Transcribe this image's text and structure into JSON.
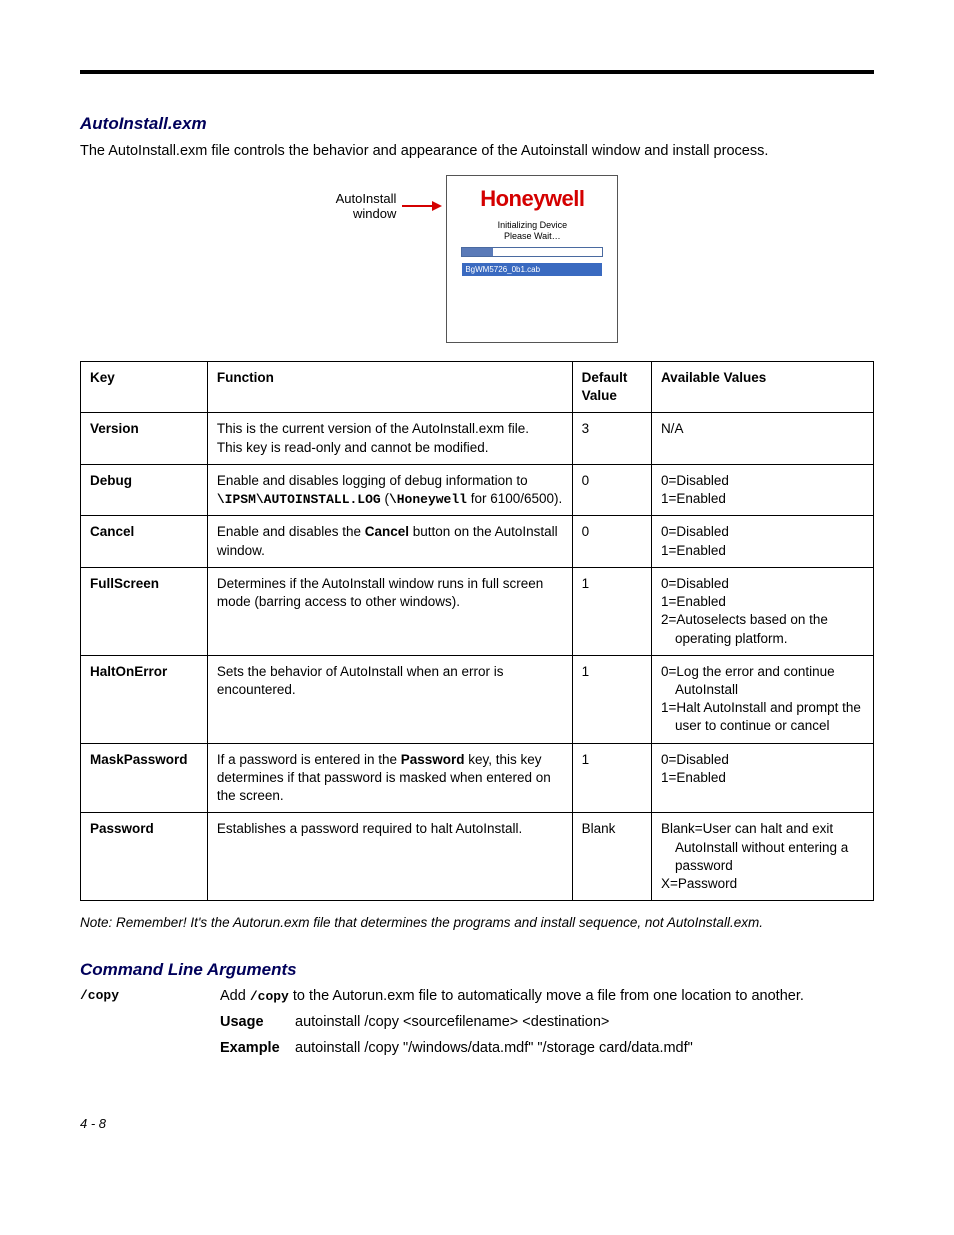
{
  "section1_title": "AutoInstall.exm",
  "intro": "The AutoInstall.exm file controls the behavior and appearance of the Autoinstall window and install process.",
  "callout_line1": "AutoInstall",
  "callout_line2": "window",
  "window_logo": "Honeywell",
  "window_line1": "Initializing Device",
  "window_line2": "Please Wait…",
  "window_file": "BgWM5726_0b1.cab",
  "table": {
    "headers": [
      "Key",
      "Function",
      "Default Value",
      "Available Values"
    ],
    "rows": [
      {
        "key": "Version",
        "function": "This is the current version of the AutoInstall.exm file.<br>This key is read-only and cannot be modified.",
        "default": "3",
        "avail": "N/A"
      },
      {
        "key": "Debug",
        "function": "Enable and disables logging of debug information to <span class='mono'>\\IPSM\\AUTOINSTALL.LOG</span> (<span class='mono'>\\Honeywell</span> for 6100/6500).",
        "default": "0",
        "avail": "0=Disabled<br>1=Enabled"
      },
      {
        "key": "Cancel",
        "function": "Enable and disables the <b>Cancel</b> button on the AutoInstall window.",
        "default": "0",
        "avail": "0=Disabled<br>1=Enabled"
      },
      {
        "key": "FullScreen",
        "function": "Determines if the AutoInstall window runs in full screen mode (barring access to other windows).",
        "default": "1",
        "avail": "0=Disabled<br>1=Enabled<br><div class='hang'>2=Autoselects based on the operating platform.</div>"
      },
      {
        "key": "HaltOnError",
        "function": "Sets the behavior of AutoInstall when an error is encountered.",
        "default": "1",
        "avail": "<div class='hang'>0=Log the error and continue AutoInstall</div><div class='hang'>1=Halt AutoInstall and prompt the user to continue or cancel</div>"
      },
      {
        "key": "MaskPassword",
        "function": "If a password is entered in the <b>Password</b> key, this key determines if that password is masked when entered on the screen.",
        "default": "1",
        "avail": "0=Disabled<br>1=Enabled"
      },
      {
        "key": "Password",
        "function": "Establishes a password required to halt AutoInstall.",
        "default": "Blank",
        "avail": "<div class='hang'>Blank=User can halt and exit AutoInstall without entering a password</div>X=Password"
      }
    ]
  },
  "note_label": "Note:",
  "note_text": "Remember! It's the Autorun.exm file that determines the programs and install sequence, not AutoInstall.exm.",
  "section2_title": "Command Line Arguments",
  "cmd_name": "/copy",
  "cmd_desc_prefix": "Add ",
  "cmd_desc_mid": "/copy",
  "cmd_desc_suffix": " to the Autorun.exm file to automatically move a file from one location to another.",
  "usage_label": "Usage",
  "usage_value": "autoinstall /copy <sourcefilename> <destination>",
  "example_label": "Example",
  "example_value": "autoinstall /copy \"/windows/data.mdf\" \"/storage card/data.mdf\"",
  "page_no": "4 - 8"
}
